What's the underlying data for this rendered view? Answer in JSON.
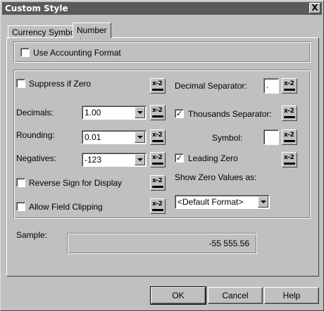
{
  "window": {
    "title": "Custom Style",
    "close_symbol": "X"
  },
  "tabs": [
    {
      "label": "Currency Symbol",
      "active": false
    },
    {
      "label": "Number",
      "active": true
    }
  ],
  "accounting": {
    "label": "Use Accounting Format",
    "checked": false
  },
  "left": {
    "suppress_if_zero": {
      "label": "Suppress if Zero",
      "checked": false
    },
    "decimals": {
      "label": "Decimals:",
      "value": "1.00"
    },
    "rounding": {
      "label": "Rounding:",
      "value": "0.01"
    },
    "negatives": {
      "label": "Negatives:",
      "value": "-123"
    },
    "reverse_sign": {
      "label": "Reverse Sign for Display",
      "checked": false
    },
    "allow_clipping": {
      "label": "Allow Field Clipping",
      "checked": false
    }
  },
  "right": {
    "decimal_separator": {
      "label": "Decimal Separator:",
      "value": "."
    },
    "thousands_separator": {
      "label": "Thousands Separator:",
      "checked": true
    },
    "symbol": {
      "label": "Symbol:",
      "value": ""
    },
    "leading_zero": {
      "label": "Leading Zero",
      "checked": true
    },
    "show_zero_as": {
      "label": "Show Zero Values as:",
      "value": "<Default Format>"
    }
  },
  "formula_button": {
    "glyph": "x-2",
    "icon": "formula-pencil-icon"
  },
  "check_glyph": "✓",
  "sample": {
    "label": "Sample:",
    "value": "-55 555.56"
  },
  "buttons": {
    "ok": "OK",
    "cancel": "Cancel",
    "help": "Help"
  }
}
